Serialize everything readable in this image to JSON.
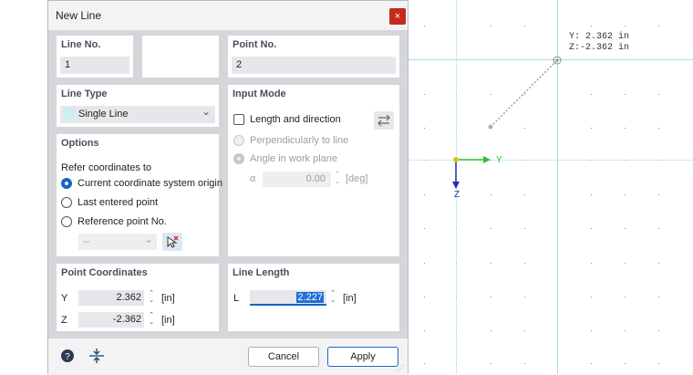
{
  "dialog": {
    "title": "New Line",
    "close_glyph": "×"
  },
  "line_no": {
    "label": "Line No.",
    "value": "1"
  },
  "point_no": {
    "label": "Point No.",
    "value": "2"
  },
  "line_type": {
    "label": "Line Type",
    "selected": "Single Line",
    "chevron": "⌄"
  },
  "input_mode": {
    "label": "Input Mode",
    "length_direction": "Length and direction",
    "perpendicular": "Perpendicularly to line",
    "angle": "Angle in work plane",
    "alpha_symbol": "α",
    "alpha_value": "0.00",
    "alpha_unit": "[deg]"
  },
  "options": {
    "label": "Options",
    "refer_text": "Refer coordinates to",
    "choices": [
      "Current coordinate system origin",
      "Last entered point",
      "Reference point No."
    ],
    "ref_point_value": "--"
  },
  "point_coords": {
    "label": "Point Coordinates",
    "y_label": "Y",
    "y_value": "2.362",
    "y_unit": "[in]",
    "z_label": "Z",
    "z_value": "-2.362",
    "z_unit": "[in]"
  },
  "line_length": {
    "label": "Line Length",
    "l_label": "L",
    "l_value": "2.227",
    "l_unit": "[in]"
  },
  "buttons": {
    "cancel": "Cancel",
    "apply": "Apply"
  },
  "viewport": {
    "coord_y": "Y: 2.362 in",
    "coord_z": "Z:-2.362 in",
    "axis_y": "Y",
    "axis_z": "Z"
  },
  "colors": {
    "accent": "#1464c8",
    "close": "#c42b1c",
    "axis_y": "#2fbf2f",
    "axis_z": "#2030b0",
    "origin": "#e0c020"
  }
}
